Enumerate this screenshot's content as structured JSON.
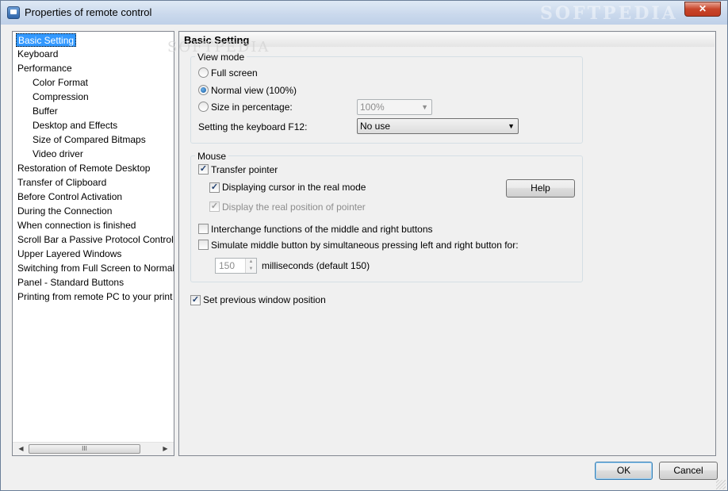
{
  "window": {
    "title": "Properties of remote control",
    "close_label": "✕",
    "watermark": "SOFTPEDIA"
  },
  "tree": {
    "items": [
      {
        "label": "Basic Setting",
        "selected": true
      },
      {
        "label": "Keyboard"
      },
      {
        "label": "Performance"
      },
      {
        "label": "Color Format"
      },
      {
        "label": "Compression"
      },
      {
        "label": "Buffer"
      },
      {
        "label": "Desktop and Effects"
      },
      {
        "label": "Size of Compared Bitmaps"
      },
      {
        "label": "Video driver"
      },
      {
        "label": "Restoration of Remote Desktop"
      },
      {
        "label": "Transfer of Clipboard"
      },
      {
        "label": "Before Control Activation"
      },
      {
        "label": "During the Connection"
      },
      {
        "label": "When connection is finished"
      },
      {
        "label": "Scroll Bar a Passive Protocol Control"
      },
      {
        "label": "Upper Layered Windows"
      },
      {
        "label": "Switching from Full Screen to Normal"
      },
      {
        "label": "Panel - Standard Buttons"
      },
      {
        "label": "Printing from remote PC to your print"
      }
    ],
    "scroll_left": "◀",
    "scroll_right": "▶",
    "scroll_thumb": "III"
  },
  "panel": {
    "header": "Basic Setting",
    "view_mode": {
      "title": "View mode",
      "full_screen": "Full screen",
      "normal_view": "Normal view (100%)",
      "size_percentage": "Size in percentage:",
      "size_value": "100%",
      "keyboard_label": "Setting the keyboard F12:",
      "keyboard_value": "No use"
    },
    "mouse": {
      "title": "Mouse",
      "transfer_pointer": "Transfer pointer",
      "displaying_cursor": "Displaying cursor in the real mode",
      "display_real_position": "Display the real position of pointer",
      "help": "Help",
      "interchange": "Interchange functions of the middle and right buttons",
      "simulate": "Simulate middle button by simultaneous pressing left and right button for:",
      "ms_value": "150",
      "ms_label": "milliseconds (default 150)"
    },
    "set_previous": "Set previous window position"
  },
  "footer": {
    "ok": "OK",
    "cancel": "Cancel"
  },
  "checked_mark": "✓"
}
